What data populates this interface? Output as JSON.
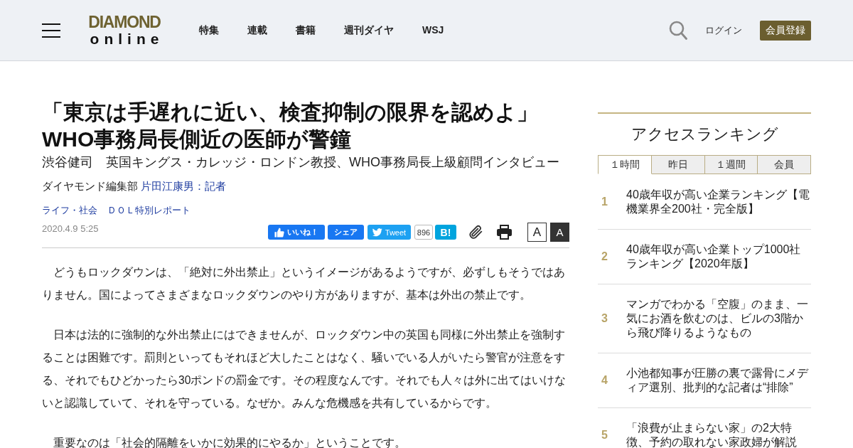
{
  "header": {
    "logo": {
      "top": "DIAMOND",
      "bottom": "online"
    },
    "nav": [
      "特集",
      "連載",
      "書籍",
      "週刊ダイヤ",
      "WSJ"
    ],
    "login": "ログイン",
    "register": "会員登録"
  },
  "article": {
    "title_lines": [
      "「東京は手遅れに近い、検査抑制の限界を認めよ」",
      "WHO事務局長側近の医師が警鐘"
    ],
    "subtitle": "渋谷健司　英国キングス・カレッジ・ロンドン教授、WHO事務局長上級顧問インタビュー",
    "byline": {
      "department": "ダイヤモンド編集部",
      "author": "片田江康男：記者"
    },
    "categories": [
      "ライフ・社会",
      "ＤＯＬ特別レポート"
    ],
    "date": "2020.4.9 5:25",
    "share": {
      "like": "いいね！",
      "share": "シェア",
      "tweet": "Tweet",
      "tweet_count": "896",
      "hatena": "B!"
    },
    "font_size_buttons": [
      {
        "label": "A",
        "selected": false
      },
      {
        "label": "A",
        "selected": true
      }
    ],
    "paragraphs": [
      "どうもロックダウンは、「絶対に外出禁止」というイメージがあるようですが、必ずしもそうではありません。国によってさまざまなロックダウンのやり方がありますが、基本は外出の禁止です。",
      "日本は法的に強制的な外出禁止にはできませんが、ロックダウン中の英国も同様に外出禁止を強制することは困難です。罰則といってもそれほど大したことはなく、騒いでいる人がいたら警官が注意をする、それでもひどかったら30ポンドの罰金です。その程度なんです。それでも人々は外に出てはいけないと認識していて、それを守っている。なぜか。みんな危機感を共有しているからです。",
      "重要なのは「社会的隔離をいかに効果的にやるか」ということです。"
    ]
  },
  "sidebar": {
    "heading": "アクセスランキング",
    "tabs": [
      {
        "label": "１時間",
        "selected": true
      },
      {
        "label": "昨日",
        "selected": false
      },
      {
        "label": "１週間",
        "selected": false
      },
      {
        "label": "会員",
        "selected": false
      }
    ],
    "ranking": [
      {
        "rank": "1",
        "title": "40歳年収が高い企業ランキング【電機業界全200社・完全版】"
      },
      {
        "rank": "2",
        "title": "40歳年収が高い企業トップ1000社ランキング【2020年版】"
      },
      {
        "rank": "3",
        "title": "マンガでわかる「空腹」のまま、一気にお酒を飲むのは、ビルの3階から飛び降りるようなもの"
      },
      {
        "rank": "4",
        "title": "小池都知事が圧勝の裏で露骨にメディア選別、批判的な記者は“排除”"
      },
      {
        "rank": "5",
        "title": "「浪費が止まらない家」の2大特徴、予約の取れない家政婦が解説"
      }
    ]
  }
}
